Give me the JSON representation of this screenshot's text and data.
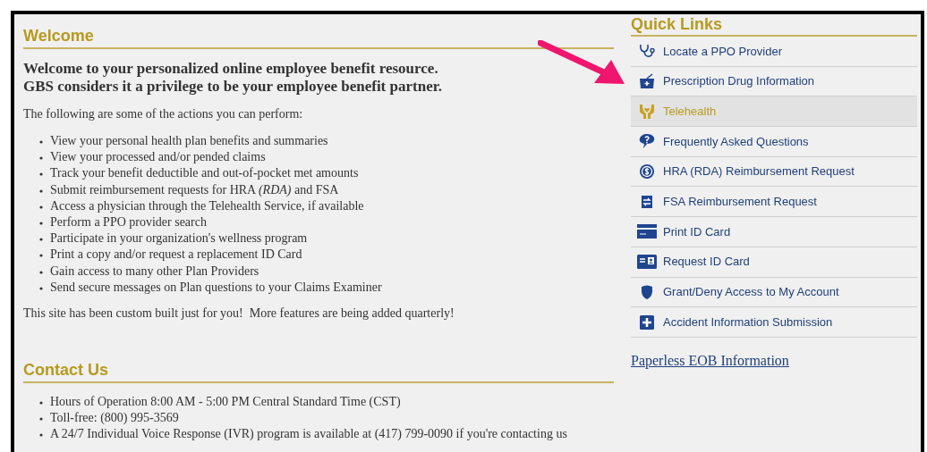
{
  "welcome": {
    "title": "Welcome",
    "heading": [
      "Welcome to your personalized online employee benefit resource.",
      "GBS considers it a privilege to be your employee benefit partner."
    ],
    "intro": "The following are some of the actions you can perform:",
    "actions": [
      "View your personal health plan benefits and summaries",
      "View your processed and/or pended claims",
      "Track your benefit deductible and out-of-pocket met amounts",
      "Submit reimbursement requests for HRA *(RDA)* and FSA",
      "Access a physician through the Telehealth Service, if available",
      "Perform a PPO provider search",
      "Participate in your organization's wellness program",
      "Print a copy and/or request a replacement ID Card",
      "Gain access to many other Plan Providers",
      "Send secure messages on Plan questions to your Claims Examiner"
    ],
    "closing": "This site has been custom built just for you!  More features are being added quarterly!"
  },
  "contact": {
    "title": "Contact Us",
    "items": [
      "Hours of Operation 8:00 AM - 5:00 PM Central Standard Time (CST)",
      "Toll-free: (800) 995-3569",
      "A 24/7 Individual Voice Response (IVR) program is available at (417) 799-0090 if you're contacting us"
    ]
  },
  "quick_links": {
    "title": "Quick Links",
    "items": [
      {
        "label": "Locate a PPO Provider",
        "selected": false
      },
      {
        "label": "Prescription Drug Information",
        "selected": false
      },
      {
        "label": "Telehealth",
        "selected": true
      },
      {
        "label": "Frequently Asked Questions",
        "selected": false
      },
      {
        "label": "HRA (RDA) Reimbursement Request",
        "selected": false
      },
      {
        "label": "FSA Reimbursement Request",
        "selected": false
      },
      {
        "label": "Print ID Card",
        "selected": false
      },
      {
        "label": "Request ID Card",
        "selected": false
      },
      {
        "label": "Grant/Deny Access to My Account",
        "selected": false
      },
      {
        "label": "Accident Information Submission",
        "selected": false
      }
    ],
    "footer_link": "Paperless EOB Information"
  }
}
